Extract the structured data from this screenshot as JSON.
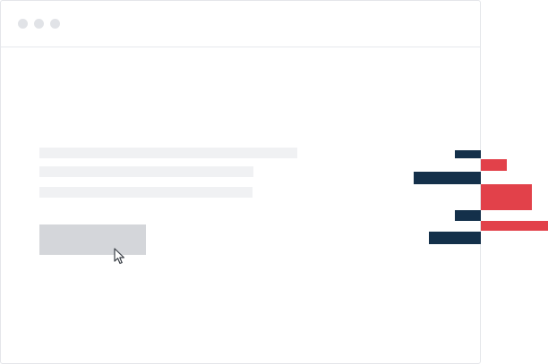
{
  "window": {
    "controls": [
      {
        "icon": "window-dot-icon",
        "color": "#e1e3e7"
      },
      {
        "icon": "window-dot-icon",
        "color": "#e1e3e7"
      },
      {
        "icon": "window-dot-icon",
        "color": "#e1e3e7"
      }
    ]
  },
  "content": {
    "placeholder_lines": 3,
    "placeholder_button": {
      "label": ""
    }
  },
  "cursor": {
    "icon": "arrow-cursor-icon"
  },
  "colors": {
    "skeleton": "#f0f1f3",
    "button": "#d4d6da",
    "navy": "#14304a",
    "red": "#e2414a",
    "border": "#e4e6ea"
  },
  "decorative_bars": {
    "icon": "bar-graphic",
    "series": [
      {
        "color": "navy",
        "count": 4
      },
      {
        "color": "red",
        "count": 3
      }
    ]
  }
}
